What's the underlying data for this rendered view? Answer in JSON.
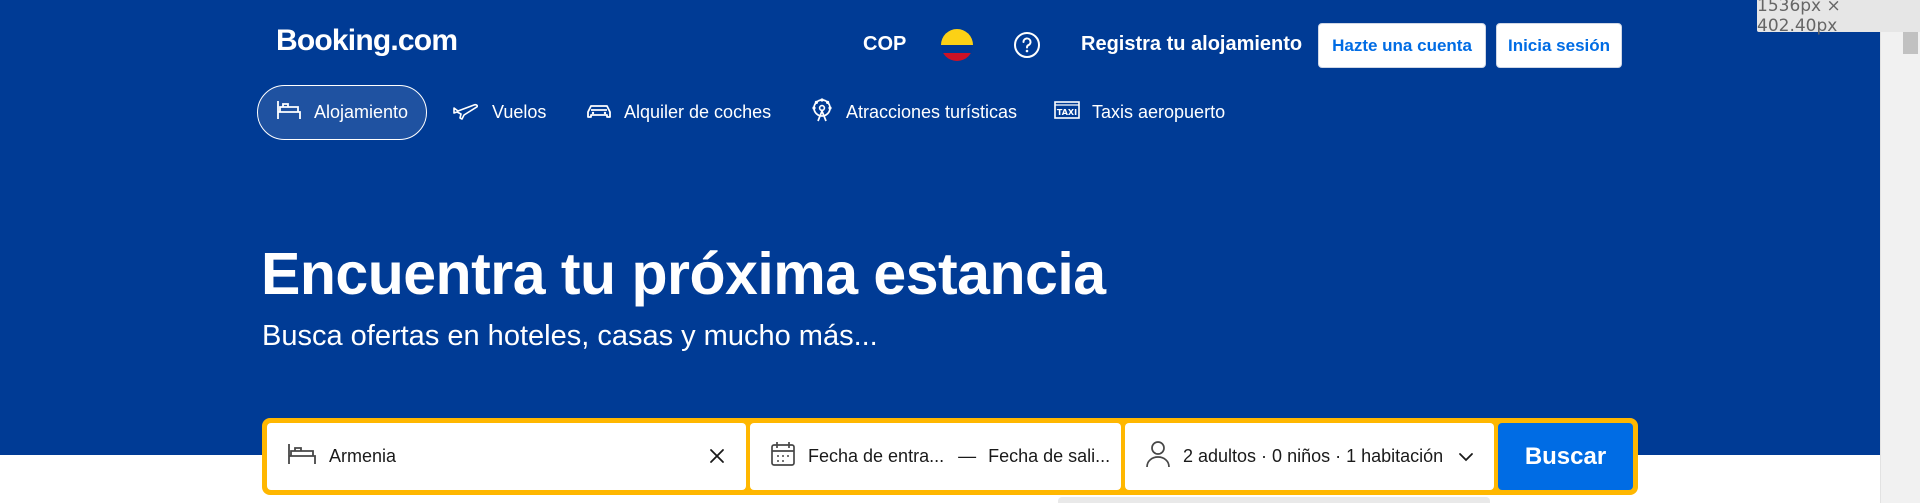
{
  "header": {
    "logo": "Booking.com",
    "currency": "COP",
    "flag_colors": [
      "#fcd116",
      "#003893",
      "#ce1126"
    ],
    "help_icon": "question-circle-icon",
    "list_property": "Registra tu alojamiento",
    "register_label": "Hazte una cuenta",
    "signin_label": "Inicia sesión"
  },
  "nav": {
    "items": [
      {
        "label": "Alojamiento",
        "icon": "bed-icon",
        "active": true
      },
      {
        "label": "Vuelos",
        "icon": "plane-icon"
      },
      {
        "label": "Alquiler de coches",
        "icon": "car-icon"
      },
      {
        "label": "Atracciones turísticas",
        "icon": "attractions-icon"
      },
      {
        "label": "Taxis aeropuerto",
        "icon": "taxi-icon"
      }
    ]
  },
  "hero": {
    "title": "Encuentra tu próxima estancia",
    "subtitle": "Busca ofertas en hoteles, casas y mucho más..."
  },
  "search": {
    "destination": "Armenia",
    "checkin": "Fecha de entra...",
    "separator": "—",
    "checkout": "Fecha de sali...",
    "guests": "2 adultos · 0 niños · 1 habitación",
    "button": "Buscar"
  },
  "overlay": {
    "dimensions": "1536px × 402.40px"
  },
  "colors": {
    "brand_blue": "#003b95",
    "accent_yellow": "#ffb700",
    "button_blue": "#006ce4"
  }
}
